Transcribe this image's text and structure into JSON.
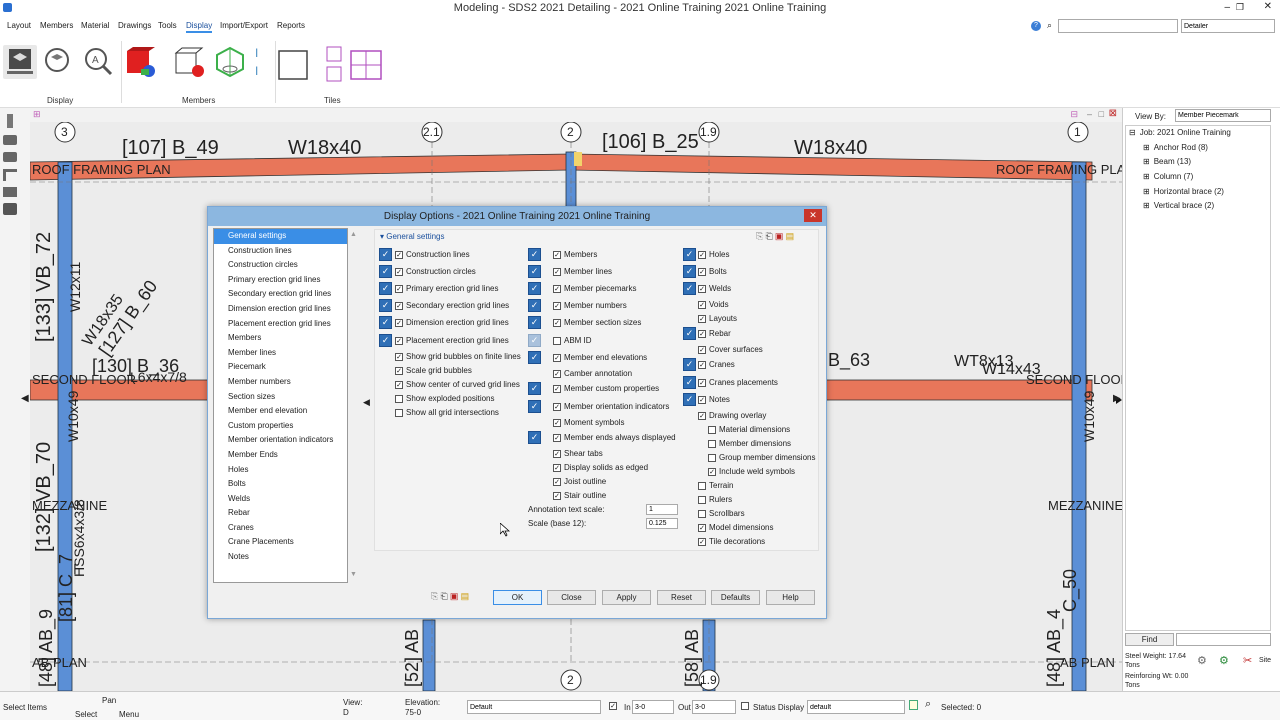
{
  "window": {
    "title": "Modeling - SDS2 2021 Detailing - 2021 Online Training 2021 Online Training"
  },
  "menu": [
    "Layout",
    "Members",
    "Material",
    "Drawings",
    "Tools",
    "Display",
    "Import/Export",
    "Reports"
  ],
  "search": {
    "value": "",
    "role_value": "Detailer"
  },
  "ribbon": {
    "groups": [
      "Display",
      "Members",
      "Tiles"
    ]
  },
  "canvas": {
    "labels": [
      "[107] B_49",
      "W18x40",
      "[106] B_25",
      "W18x40",
      "ROOF FRAMING PLAN",
      "ROOF FRAMING PLAN",
      "[133] VB_72",
      "W12x11",
      "W18x35",
      "[127] B_60",
      "[130] B_36",
      "L6x4x7/8",
      "SECOND FLOOR",
      "SECOND FLOOR",
      "B_63",
      "WT8x13",
      "W14x43",
      "W10x49",
      "W10x49",
      "[132] VB_70",
      "MEZZANINE",
      "MEZZANINE",
      "HSS6x4x3/8",
      "[48] AB_9",
      "[81] C_7",
      "[48] AB_4",
      "C_50",
      "AB PLAN",
      "AB PLAN",
      "[52] AB",
      "[58] AB"
    ],
    "grid": [
      "3",
      "2.1",
      "2",
      "1.9",
      "1",
      "2",
      "1.9"
    ]
  },
  "dialog": {
    "title": "Display Options - 2021 Online Training 2021 Online Training",
    "categories": [
      "General settings",
      "Construction lines",
      "Construction circles",
      "Primary erection grid lines",
      "Secondary erection grid lines",
      "Dimension erection grid lines",
      "Placement erection grid lines",
      "Members",
      "Member lines",
      "Piecemark",
      "Member numbers",
      "Section sizes",
      "Member end elevation",
      "Custom properties",
      "Member orientation indicators",
      "Member Ends",
      "Holes",
      "Bolts",
      "Welds",
      "Rebar",
      "Cranes",
      "Crane Placements",
      "Notes"
    ],
    "section": "General settings",
    "col1": [
      {
        "label": "Construction lines",
        "checked": true,
        "lock": true
      },
      {
        "label": "Construction circles",
        "checked": true,
        "lock": true
      },
      {
        "label": "Primary erection grid lines",
        "checked": true,
        "lock": true
      },
      {
        "label": "Secondary erection grid lines",
        "checked": true,
        "lock": true
      },
      {
        "label": "Dimension erection grid lines",
        "checked": true,
        "lock": true
      },
      {
        "label": "Placement erection grid lines",
        "checked": true,
        "lock": true
      },
      {
        "label": "Show grid bubbles on finite lines",
        "checked": true,
        "lock": false
      },
      {
        "label": "Scale grid bubbles",
        "checked": true,
        "lock": false
      },
      {
        "label": "Show center of curved grid lines",
        "checked": true,
        "lock": false
      },
      {
        "label": "Show exploded positions",
        "checked": false,
        "lock": false
      },
      {
        "label": "Show all grid intersections",
        "checked": false,
        "lock": false
      }
    ],
    "col2": [
      {
        "label": "Members",
        "checked": true,
        "lock": true
      },
      {
        "label": "Member lines",
        "checked": true,
        "lock": true
      },
      {
        "label": "Member piecemarks",
        "checked": true,
        "lock": true
      },
      {
        "label": "Member numbers",
        "checked": true,
        "lock": true
      },
      {
        "label": "Member section sizes",
        "checked": true,
        "lock": true
      },
      {
        "label": "ABM ID",
        "checked": false,
        "lock": true
      },
      {
        "label": "Member end elevations",
        "checked": true,
        "lock": true
      },
      {
        "label": "Camber annotation",
        "checked": true,
        "lock": false
      },
      {
        "label": "Member custom properties",
        "checked": true,
        "lock": true
      },
      {
        "label": "Member orientation indicators",
        "checked": true,
        "lock": true
      },
      {
        "label": "Moment symbols",
        "checked": true,
        "lock": false
      },
      {
        "label": "Member ends always displayed",
        "checked": true,
        "lock": true
      },
      {
        "label": "Shear tabs",
        "checked": true,
        "lock": false
      },
      {
        "label": "Display solids as edged",
        "checked": true,
        "lock": false
      },
      {
        "label": "Joist outline",
        "checked": true,
        "lock": false
      },
      {
        "label": "Stair outline",
        "checked": true,
        "lock": false
      }
    ],
    "annotation_scale_label": "Annotation text scale:",
    "annotation_scale_value": "1",
    "scale_label": "Scale (base 12):",
    "scale_value": "0.125",
    "col3": [
      {
        "label": "Holes",
        "checked": true,
        "lock": true
      },
      {
        "label": "Bolts",
        "checked": true,
        "lock": true
      },
      {
        "label": "Welds",
        "checked": true,
        "lock": true
      },
      {
        "label": "Voids",
        "checked": true,
        "lock": false
      },
      {
        "label": "Layouts",
        "checked": true,
        "lock": false
      },
      {
        "label": "Rebar",
        "checked": true,
        "lock": true
      },
      {
        "label": "Cover surfaces",
        "checked": true,
        "lock": false
      },
      {
        "label": "Cranes",
        "checked": true,
        "lock": true
      },
      {
        "label": "Cranes placements",
        "checked": true,
        "lock": true
      },
      {
        "label": "Notes",
        "checked": true,
        "lock": true
      },
      {
        "label": "Drawing overlay",
        "checked": true,
        "lock": false
      },
      {
        "label": "Material dimensions",
        "checked": false,
        "lock": false,
        "indent": true
      },
      {
        "label": "Member dimensions",
        "checked": false,
        "lock": false,
        "indent": true
      },
      {
        "label": "Group member dimensions",
        "checked": false,
        "lock": false,
        "indent": true
      },
      {
        "label": "Include weld symbols",
        "checked": true,
        "lock": false,
        "indent": true
      },
      {
        "label": "Terrain",
        "checked": false,
        "lock": false
      },
      {
        "label": "Rulers",
        "checked": false,
        "lock": false
      },
      {
        "label": "Scrollbars",
        "checked": false,
        "lock": false
      },
      {
        "label": "Model dimensions",
        "checked": true,
        "lock": false
      },
      {
        "label": "Tile decorations",
        "checked": true,
        "lock": false
      }
    ],
    "buttons": {
      "ok": "OK",
      "close": "Close",
      "apply": "Apply",
      "reset": "Reset",
      "defaults": "Defaults",
      "help": "Help"
    },
    "close_glyph": "✕"
  },
  "right": {
    "viewby_label": "View By:",
    "viewby_value": "Member Piecemark",
    "tree": [
      "Job: 2021 Online Training",
      "Anchor Rod (8)",
      "Beam (13)",
      "Column (7)",
      "Horizontal brace (2)",
      "Vertical brace (2)"
    ],
    "find": "Find",
    "steel_weight": "Steel Weight: 17.64 Tons",
    "reinforcing": "Reinforcing Wt: 0.00 Tons",
    "site": "Site"
  },
  "status": {
    "select_items": "Select Items",
    "pan": "Pan",
    "select": "Select",
    "menu": "Menu",
    "view_label": "View:",
    "view_value": "D",
    "elevation_label": "Elevation:",
    "elevation_value": "75-0",
    "default_value": "Default",
    "in_label": "In",
    "in_value": "3-0",
    "out_label": "Out",
    "out_value": "3-0",
    "status_display": "Status Display",
    "status_value": "default",
    "selected": "Selected: 0"
  },
  "colors": {
    "accent": "#3a8ee6",
    "beam": "#e8765a",
    "column": "#5b8fd6",
    "dialog_title": "#8cb7e0"
  }
}
